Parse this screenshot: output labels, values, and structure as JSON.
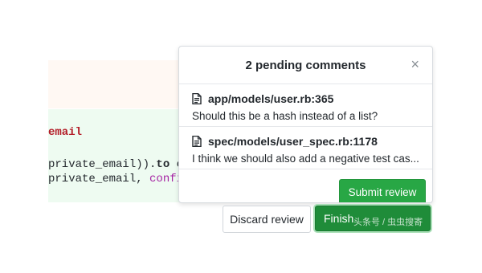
{
  "code": {
    "line1": "email",
    "line2_prefix": "private_email)).",
    "line2_kw": "to",
    "line2_rest": " eq([u",
    "line3_prefix": "private_email, ",
    "line3_kw": "confirmec"
  },
  "popover": {
    "title": "2 pending comments",
    "close_label": "×",
    "comments": [
      {
        "file": "app/models/user.rb:365",
        "text": "Should this be a hash instead of a list?"
      },
      {
        "file": "spec/models/user_spec.rb:1178",
        "text": "I think we should also add a negative test cas..."
      }
    ],
    "submit_label": "Submit review"
  },
  "actions": {
    "discard_label": "Discard review",
    "finish_label": "Finish"
  },
  "watermark": "头条号 / 虫虫搜寄",
  "colors": {
    "accent_green": "#28a745",
    "finish_green": "#1f8c39"
  }
}
